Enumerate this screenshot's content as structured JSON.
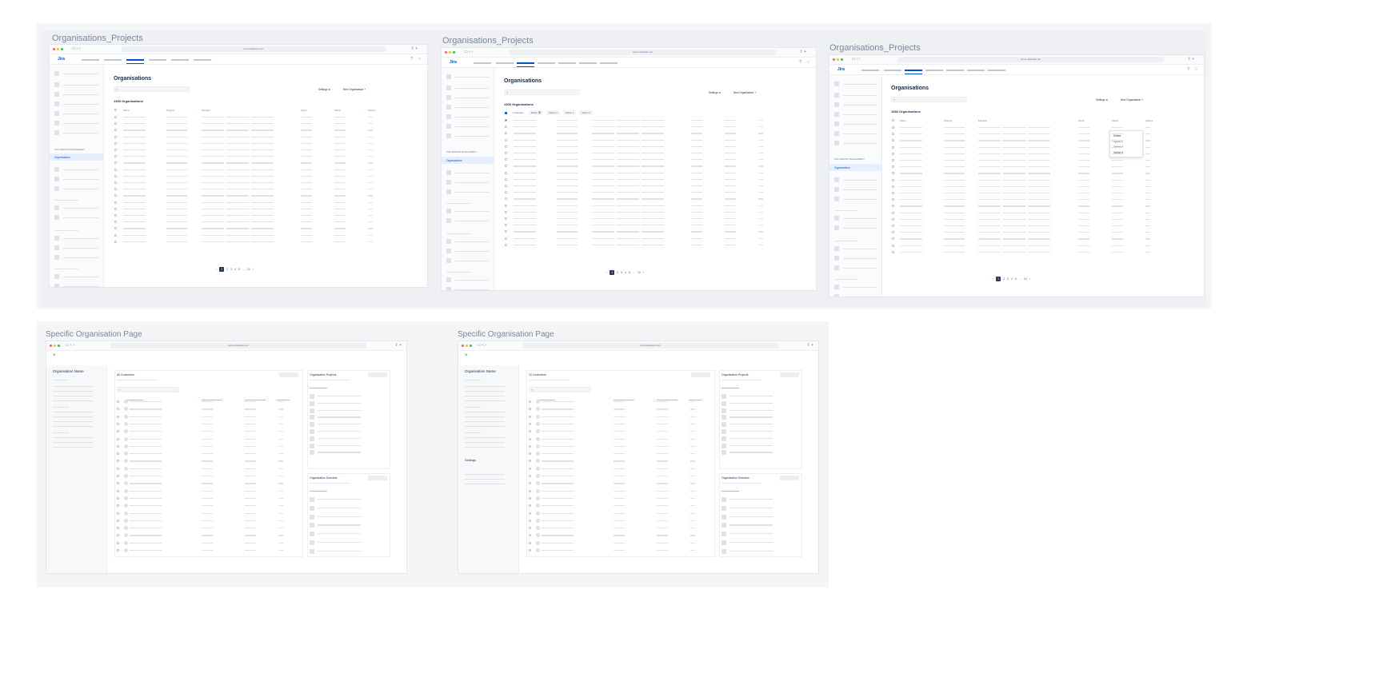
{
  "colors": {
    "accent": "#0052cc",
    "dot_red": "#ff5f57",
    "dot_yellow": "#febc2e",
    "dot_green": "#28c840"
  },
  "sections": {
    "top_title": "Organisations_Projects",
    "bottom_title": "Specific Organisation Page"
  },
  "browser": {
    "url_org": "acme.atlassian.net",
    "url_specific": "acme.atlassian.net"
  },
  "app": {
    "logo_text": "Jira"
  },
  "org_list": {
    "page_title": "Organisations",
    "search_icon": "search-icon",
    "settings_label": "Settings",
    "new_org_label": "New Organisation",
    "count_label": "1300 Organisations",
    "count_label_3": "1083 Organisations",
    "sidebar_section": "JIRA SERVICE MANAGEMENT",
    "sidebar_selected": "Organisations",
    "headers": [
      "Name",
      "Projects",
      "Domains",
      "Users",
      "Status",
      "Actions"
    ],
    "pages": [
      "1",
      "2",
      "3",
      "4",
      "5",
      "...",
      "10"
    ],
    "prev": "‹",
    "next": "›"
  },
  "bulk": {
    "selected": "1 selected",
    "delete": "Delete",
    "opt2": "Option 2",
    "opt3": "Option 3",
    "opt4": "Option 4"
  },
  "dropdown": {
    "items": [
      "Delete",
      "Option 2",
      "Option 3",
      "Option 4"
    ]
  },
  "specific": {
    "close": "×",
    "org_name": "Organisation Name",
    "all_customers": "All Customers",
    "customers_count": "10 Customers",
    "org_projects": "Organisation Projects",
    "org_domains": "Organisation Domains",
    "settings": "Settings"
  }
}
